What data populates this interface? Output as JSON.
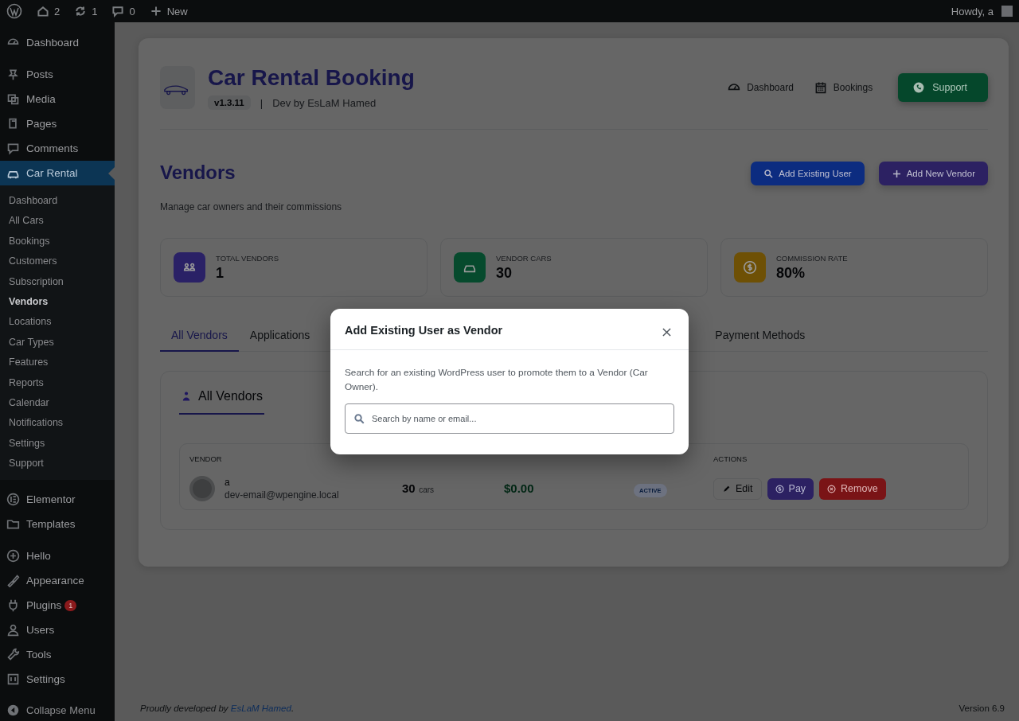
{
  "admin_bar": {
    "items": [
      {
        "label": "2"
      },
      {
        "label": "1"
      },
      {
        "label": "0"
      },
      {
        "label": "New"
      }
    ],
    "greeting": "Howdy, a"
  },
  "sidebar": {
    "groups": [
      {
        "items": [
          {
            "label": "Dashboard",
            "selected": false
          }
        ]
      },
      {
        "items": [
          {
            "label": "Posts",
            "selected": false
          },
          {
            "label": "Media",
            "selected": false
          },
          {
            "label": "Pages",
            "selected": false
          },
          {
            "label": "Comments",
            "selected": false
          },
          {
            "label": "Car Rental",
            "selected": true,
            "children": [
              {
                "label": "Dashboard",
                "selected": false
              },
              {
                "label": "All Cars",
                "selected": false
              },
              {
                "label": "Bookings",
                "selected": false
              },
              {
                "label": "Customers",
                "selected": false
              },
              {
                "label": "Subscription",
                "selected": false
              },
              {
                "label": "Vendors",
                "selected": true
              },
              {
                "label": "Locations",
                "selected": false
              },
              {
                "label": "Car Types",
                "selected": false
              },
              {
                "label": "Features",
                "selected": false
              },
              {
                "label": "Reports",
                "selected": false
              },
              {
                "label": "Calendar",
                "selected": false
              },
              {
                "label": "Notifications",
                "selected": false
              },
              {
                "label": "Settings",
                "selected": false
              },
              {
                "label": "Support",
                "selected": false
              }
            ]
          }
        ]
      },
      {
        "items": [
          {
            "label": "Elementor",
            "selected": false
          },
          {
            "label": "Templates",
            "selected": false
          }
        ]
      },
      {
        "items": [
          {
            "label": "Hello",
            "selected": false
          },
          {
            "label": "Appearance",
            "selected": false
          },
          {
            "label": "Plugins",
            "selected": false,
            "badge": "1"
          },
          {
            "label": "Users",
            "selected": false
          },
          {
            "label": "Tools",
            "selected": false
          },
          {
            "label": "Settings",
            "selected": false
          }
        ]
      }
    ],
    "collapse": "Collapse Menu"
  },
  "header": {
    "title": "Car Rental Booking",
    "version": "v1.3.11",
    "separator": "|",
    "dev": "Dev by EsLaM Hamed",
    "links": [
      "Dashboard",
      "Bookings"
    ],
    "support": "Support"
  },
  "page": {
    "title": "Vendors",
    "subtitle": "Manage car owners and their commissions",
    "buttons": [
      "Add Existing User",
      "Add New Vendor"
    ]
  },
  "stats": [
    {
      "label": "TOTAL VENDORS",
      "value": "1",
      "color": "#2a2166"
    },
    {
      "label": "VENDOR CARS",
      "value": "30",
      "color": "#064a2d"
    },
    {
      "label": "COMMISSION RATE",
      "value": "80%",
      "color": "#6e5005"
    }
  ],
  "tabs": [
    {
      "label": "All Vendors",
      "selected": true
    },
    {
      "label": "Applications",
      "selected": false
    },
    {
      "label": "Payment Methods",
      "selected": false
    }
  ],
  "panel": {
    "title": "All Vendors",
    "columns": [
      "VENDOR",
      "ACTIONS"
    ],
    "rows": [
      {
        "name": "a",
        "email": "dev-email@wpengine.local",
        "cars": "30",
        "cars_unit": "cars",
        "earnings": "$0.00",
        "status": "ACTIVE",
        "actions": [
          "Edit",
          "Pay",
          "Remove"
        ]
      }
    ]
  },
  "modal": {
    "title": "Add Existing User as Vendor",
    "text": "Search for an existing WordPress user to promote them to a Vendor (Car Owner).",
    "placeholder": "Search by name or email..."
  },
  "footer": {
    "text": "Proudly developed by ",
    "link": "EsLaM Hamed",
    "end": ".",
    "version": "Version 6.9"
  }
}
